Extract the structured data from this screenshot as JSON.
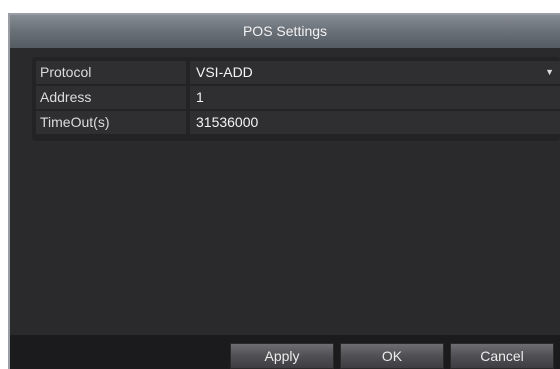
{
  "dialog": {
    "title": "POS Settings"
  },
  "fields": [
    {
      "label": "Protocol",
      "value": "VSI-ADD",
      "type": "dropdown"
    },
    {
      "label": "Address",
      "value": "1",
      "type": "text"
    },
    {
      "label": "TimeOut(s)",
      "value": "31536000",
      "type": "text"
    }
  ],
  "buttons": {
    "apply": "Apply",
    "ok": "OK",
    "cancel": "Cancel"
  },
  "icons": {
    "protocol_dropdown": "chevron-down-icon"
  }
}
